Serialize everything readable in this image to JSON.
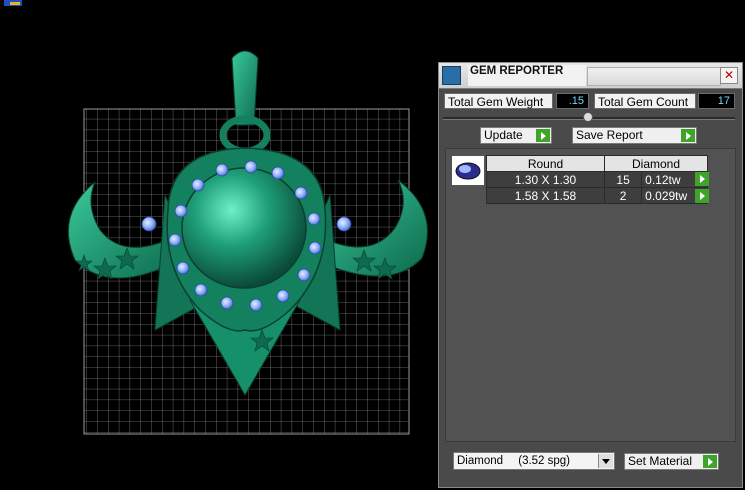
{
  "panel": {
    "title": "GEM REPORTER",
    "close_glyph": "✕",
    "total_weight_label": "Total Gem Weight",
    "total_weight_value": ".15",
    "total_count_label": "Total Gem Count",
    "total_count_value": "17",
    "update_label": "Update",
    "save_label": "Save Report",
    "table": {
      "headers": [
        "Round",
        "Diamond"
      ],
      "rows": [
        {
          "size": "1.30 X 1.30",
          "count": "15",
          "weight": "0.12tw"
        },
        {
          "size": "1.58 X 1.58",
          "count": "2",
          "weight": "0.029tw"
        }
      ]
    },
    "material_select": {
      "value": "Diamond",
      "density": "(3.52 spg)"
    },
    "set_material_label": "Set Material"
  },
  "icons": [
    "gem-reporter-app-icon",
    "close-icon",
    "play-arrow-icon",
    "dropdown-arrow-icon",
    "oval-gem-icon"
  ],
  "colors": {
    "model": "#1fa07a",
    "gem": "#8fb0ff",
    "grid": "#8a8a8a",
    "accent": "#3fa52a",
    "value_text": "#6fd8ff"
  }
}
